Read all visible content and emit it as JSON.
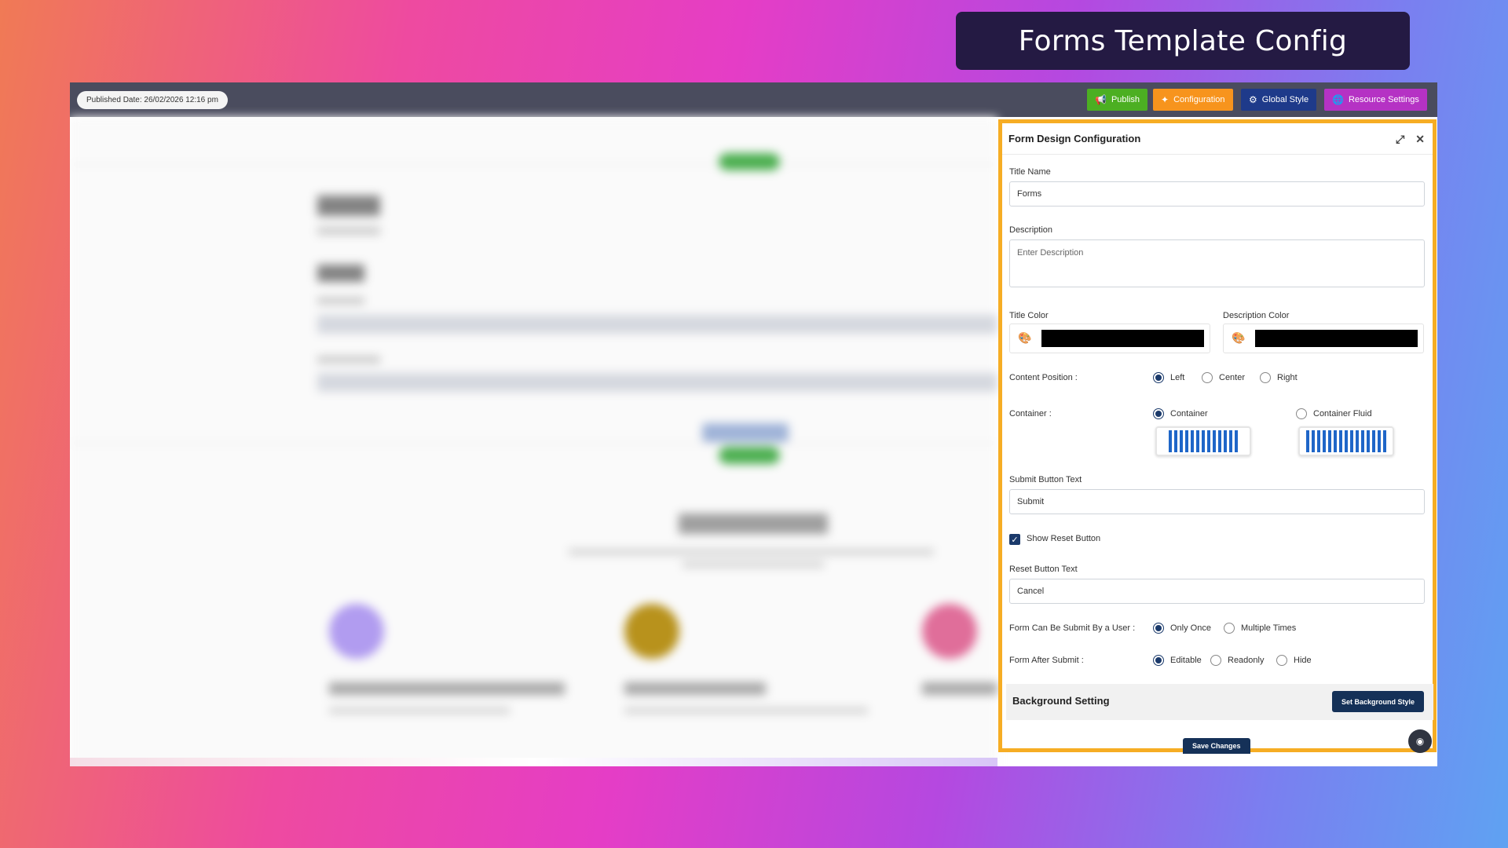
{
  "banner": {
    "title": "Forms Template Config"
  },
  "topbar": {
    "published_date": "Published Date: 26/02/2026 12:16 pm",
    "buttons": [
      {
        "label": "Publish",
        "icon": "megaphone-icon",
        "color": "#4caf22"
      },
      {
        "label": "Configuration",
        "icon": "sparkle-icon",
        "color": "#f7941d"
      },
      {
        "label": "Global Style",
        "icon": "gear-icon",
        "color": "#1e3a8a"
      },
      {
        "label": "Resource Settings",
        "icon": "globe-icon",
        "color": "#b532c4"
      }
    ]
  },
  "panel": {
    "title": "Form Design Configuration",
    "title_name": {
      "label": "Title Name",
      "value": "Forms"
    },
    "description": {
      "label": "Description",
      "placeholder": "Enter Description"
    },
    "title_color": {
      "label": "Title Color",
      "value": "#000000"
    },
    "description_color": {
      "label": "Description Color",
      "value": "#000000"
    },
    "content_position": {
      "label": "Content Position :",
      "options": [
        "Left",
        "Center",
        "Right"
      ],
      "selected": "Left"
    },
    "container": {
      "label": "Container :",
      "options": [
        "Container",
        "Container Fluid"
      ],
      "selected": "Container"
    },
    "submit_button": {
      "label": "Submit Button Text",
      "value": "Submit"
    },
    "show_reset": {
      "label": "Show Reset Button",
      "checked": true
    },
    "reset_button": {
      "label": "Reset Button Text",
      "value": "Cancel"
    },
    "submit_by_user": {
      "label": "Form Can Be Submit By a User :",
      "options": [
        "Only Once",
        "Multiple Times"
      ],
      "selected": "Only Once"
    },
    "after_submit": {
      "label": "Form After Submit :",
      "options": [
        "Editable",
        "Readonly",
        "Hide"
      ],
      "selected": "Editable"
    },
    "background": {
      "title": "Background Setting",
      "button": "Set Background Style"
    },
    "save_button": "Save Changes"
  }
}
